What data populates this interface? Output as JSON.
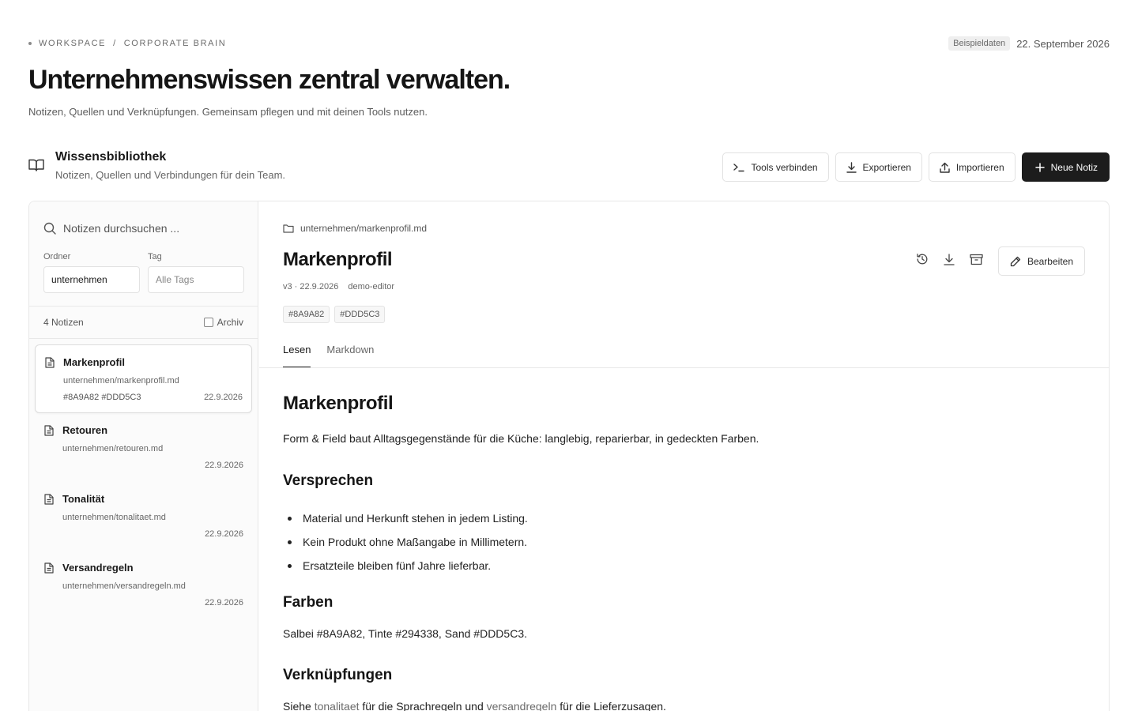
{
  "breadcrumb": {
    "root": "WORKSPACE",
    "sep": "/",
    "current": "CORPORATE BRAIN"
  },
  "badge": "Beispieldaten",
  "date": "22. September 2026",
  "hero": {
    "title": "Unternehmenswissen zentral verwalten.",
    "subtitle": "Notizen, Quellen und Verknüpfungen. Gemeinsam pflegen und mit deinen Tools nutzen."
  },
  "library": {
    "title": "Wissensbibliothek",
    "subtitle": "Notizen, Quellen und Verbindungen für dein Team."
  },
  "actions": {
    "tools": "Tools verbinden",
    "export": "Exportieren",
    "import": "Importieren",
    "new_note": "Neue Notiz"
  },
  "sidebar": {
    "search_placeholder": "Notizen durchsuchen ...",
    "folder_label": "Ordner",
    "folder_value": "unternehmen",
    "tag_label": "Tag",
    "tag_placeholder": "Alle Tags",
    "count": "4 Notizen",
    "archive_label": "Archiv",
    "notes": [
      {
        "title": "Markenprofil",
        "path": "unternehmen/markenprofil.md",
        "tags": "#8A9A82 #DDD5C3",
        "date": "22.9.2026"
      },
      {
        "title": "Retouren",
        "path": "unternehmen/retouren.md",
        "tags": "",
        "date": "22.9.2026"
      },
      {
        "title": "Tonalität",
        "path": "unternehmen/tonalitaet.md",
        "tags": "",
        "date": "22.9.2026"
      },
      {
        "title": "Versandregeln",
        "path": "unternehmen/versandregeln.md",
        "tags": "",
        "date": "22.9.2026"
      }
    ]
  },
  "note": {
    "path": "unternehmen/markenprofil.md",
    "title": "Markenprofil",
    "version": "v3 · 22.9.2026",
    "author": "demo-editor",
    "tags": [
      "#8A9A82",
      "#DDD5C3"
    ],
    "edit_label": "Bearbeiten",
    "tabs": [
      "Lesen",
      "Markdown"
    ],
    "body": {
      "h1": "Markenprofil",
      "intro": "Form & Field baut Alltagsgegenstände für die Küche: langlebig, reparierbar, in gedeckten Farben.",
      "h2_promise": "Versprechen",
      "bullets": [
        "Material und Herkunft stehen in jedem Listing.",
        "Kein Produkt ohne Maßangabe in Millimetern.",
        "Ersatzteile bleiben fünf Jahre lieferbar."
      ],
      "h2_colors": "Farben",
      "colors_text": "Salbei #8A9A82, Tinte #294338, Sand #DDD5C3.",
      "h2_links": "Verknüpfungen",
      "links_pre": "Siehe",
      "link1": "tonalitaet",
      "links_mid": "für die Sprachregeln und",
      "link2": "versandregeln",
      "links_post": "für die Lieferzusagen."
    }
  }
}
